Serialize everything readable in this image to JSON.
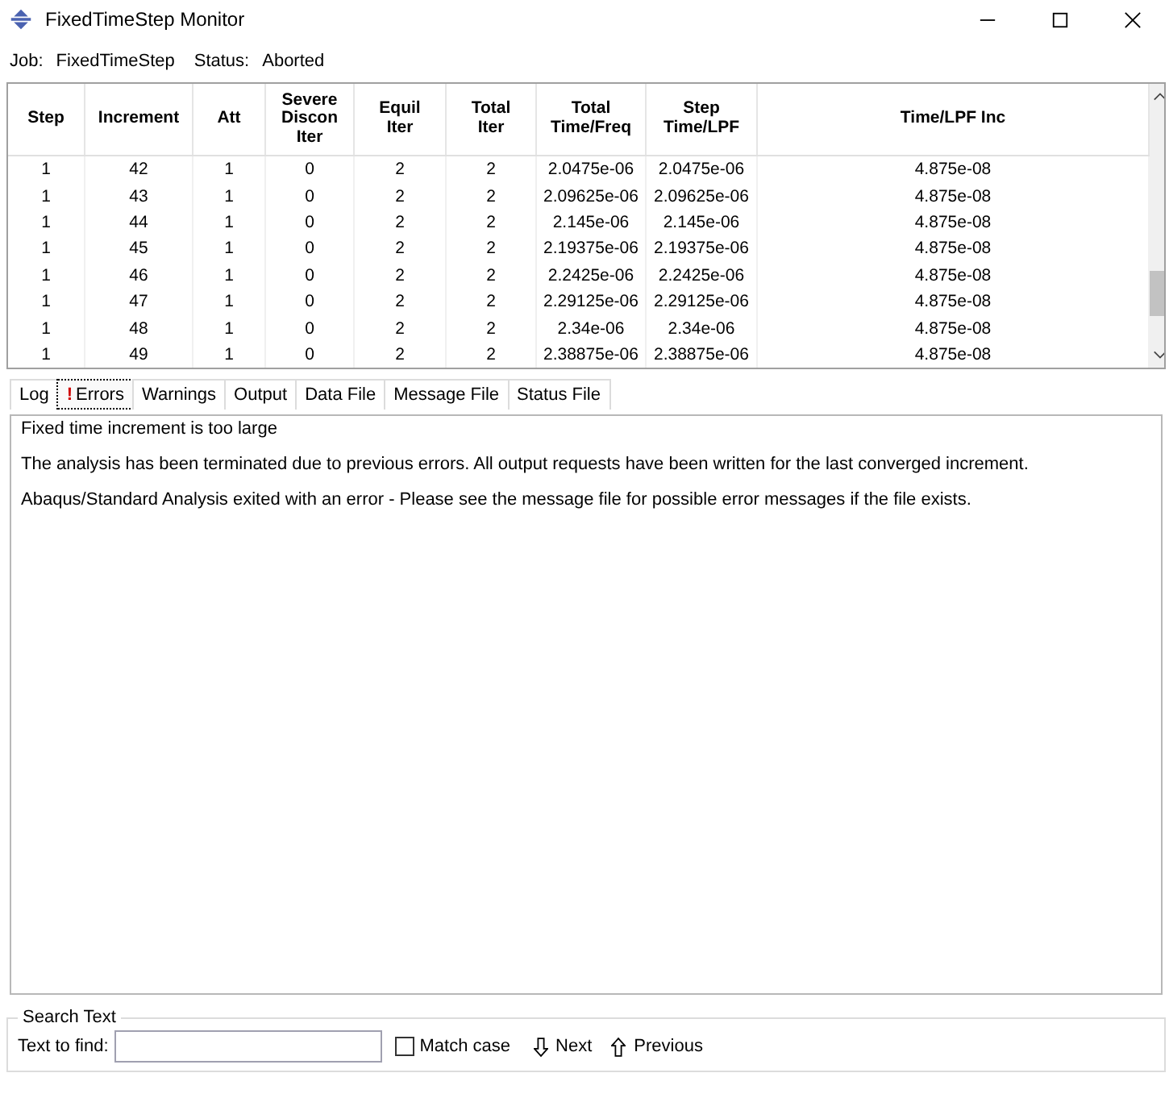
{
  "window": {
    "title": "FixedTimeStep Monitor"
  },
  "job": {
    "job_label": "Job:",
    "job_value": "FixedTimeStep",
    "status_label": "Status:",
    "status_value": "Aborted"
  },
  "table": {
    "columns": [
      "Step",
      "Increment",
      "Att",
      "Severe Discon Iter",
      "Equil Iter",
      "Total Iter",
      "Total Time/Freq",
      "Step Time/LPF",
      "Time/LPF Inc"
    ],
    "rows": [
      [
        "1",
        "42",
        "1",
        "0",
        "2",
        "2",
        "2.0475e-06",
        "2.0475e-06",
        "4.875e-08"
      ],
      [
        "1",
        "43",
        "1",
        "0",
        "2",
        "2",
        "2.09625e-06",
        "2.09625e-06",
        "4.875e-08"
      ],
      [
        "1",
        "44",
        "1",
        "0",
        "2",
        "2",
        "2.145e-06",
        "2.145e-06",
        "4.875e-08"
      ],
      [
        "1",
        "45",
        "1",
        "0",
        "2",
        "2",
        "2.19375e-06",
        "2.19375e-06",
        "4.875e-08"
      ],
      [
        "1",
        "46",
        "1",
        "0",
        "2",
        "2",
        "2.2425e-06",
        "2.2425e-06",
        "4.875e-08"
      ],
      [
        "1",
        "47",
        "1",
        "0",
        "2",
        "2",
        "2.29125e-06",
        "2.29125e-06",
        "4.875e-08"
      ],
      [
        "1",
        "48",
        "1",
        "0",
        "2",
        "2",
        "2.34e-06",
        "2.34e-06",
        "4.875e-08"
      ],
      [
        "1",
        "49",
        "1",
        "0",
        "2",
        "2",
        "2.38875e-06",
        "2.38875e-06",
        "4.875e-08"
      ]
    ]
  },
  "tabs": [
    {
      "label": "Log",
      "selected": false,
      "error": false
    },
    {
      "label": "Errors",
      "selected": true,
      "error": true
    },
    {
      "label": "Warnings",
      "selected": false,
      "error": false
    },
    {
      "label": "Output",
      "selected": false,
      "error": false
    },
    {
      "label": "Data File",
      "selected": false,
      "error": false
    },
    {
      "label": "Message File",
      "selected": false,
      "error": false
    },
    {
      "label": "Status File",
      "selected": false,
      "error": false
    }
  ],
  "error_icon": "!",
  "messages": [
    "Fixed time increment is too large",
    "The analysis has been terminated due to previous errors. All output requests have been written for the last converged increment.",
    "Abaqus/Standard Analysis exited with an error - Please see the  message file for possible error messages if the file exists."
  ],
  "search": {
    "title": "Search Text",
    "label": "Text to find:",
    "match_case": {
      "label": "Match case",
      "checked": false
    },
    "next": "Next",
    "previous": "Previous"
  }
}
